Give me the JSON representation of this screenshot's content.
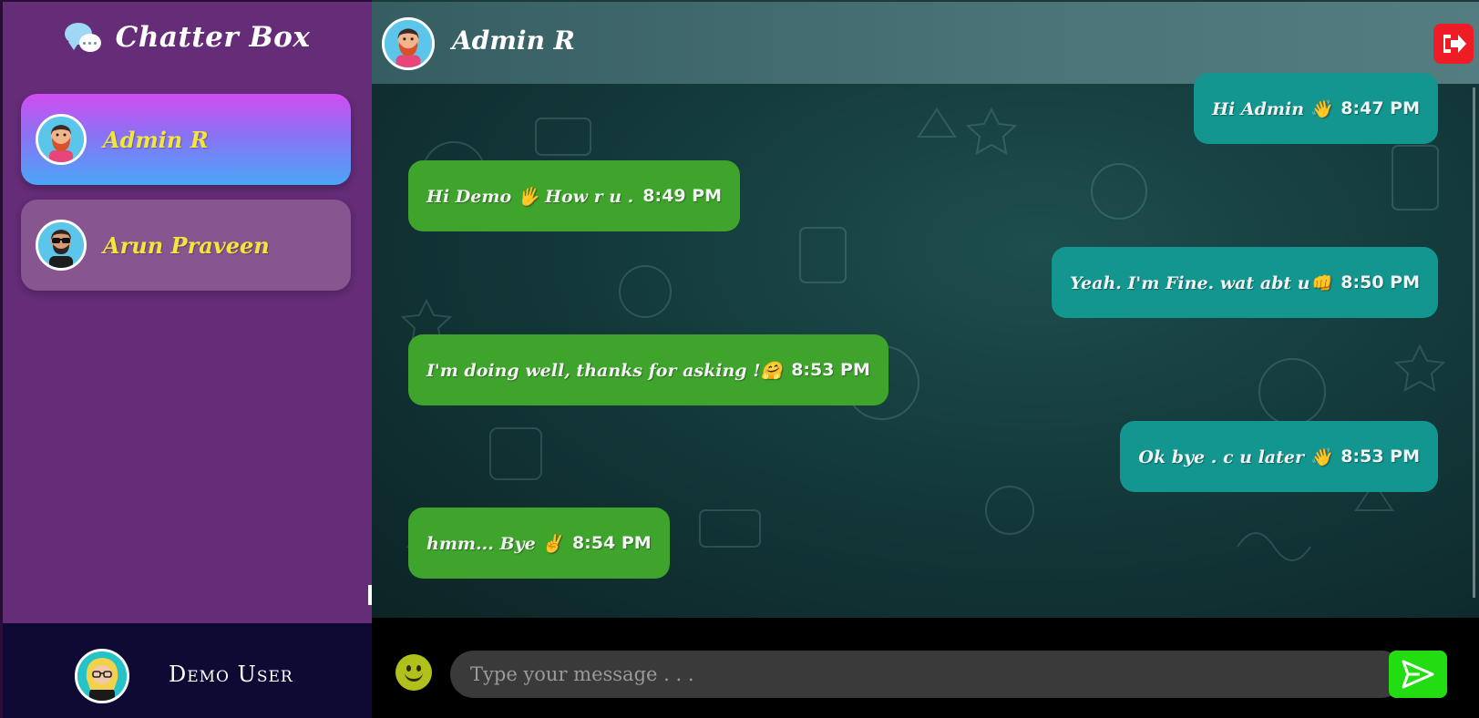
{
  "app": {
    "title": "Chatter Box"
  },
  "sidebar": {
    "contacts": [
      {
        "name": "Admin R",
        "active": true
      },
      {
        "name": "Arun Praveen",
        "active": false
      }
    ],
    "current_user": {
      "name": "Demo User"
    }
  },
  "chat": {
    "header": {
      "name": "Admin R"
    },
    "messages": [
      {
        "direction": "out",
        "text": "Hi Admin 👋",
        "time": "8:47 PM"
      },
      {
        "direction": "in",
        "text": "Hi Demo 🖐 How r u .",
        "time": "8:49 PM"
      },
      {
        "direction": "out",
        "text": "Yeah. I'm Fine. wat abt u👊",
        "time": "8:50 PM"
      },
      {
        "direction": "in",
        "text": "I'm doing well, thanks for asking !🤗",
        "time": "8:53 PM"
      },
      {
        "direction": "out",
        "text": "Ok bye . c u later 👋",
        "time": "8:53 PM"
      },
      {
        "direction": "in",
        "text": "hmm... Bye ✌",
        "time": "8:54 PM"
      }
    ]
  },
  "composer": {
    "placeholder": "Type your message . . .",
    "value": ""
  },
  "icons": {
    "logout": "logout-icon",
    "send": "send-icon",
    "emoji": "emoji-icon",
    "brand": "chat-bubbles-icon"
  },
  "colors": {
    "sidebar_bg": "#652c78",
    "active_contact_gradient": [
      "#d24df0",
      "#4aa6f8"
    ],
    "incoming_bubble": "#3fa42c",
    "outgoing_bubble": "#12968f",
    "contact_name": "#f5e43c",
    "logout_button": "#ee1c24",
    "send_button": "#22dd11"
  }
}
